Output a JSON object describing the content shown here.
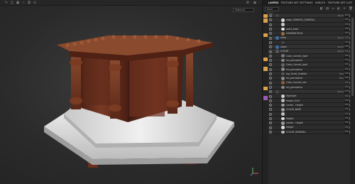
{
  "app": {
    "accent": "#d9a14a"
  },
  "viewport": {
    "view_select": "Base Color",
    "material_select": "Material",
    "toolbar_icons": [
      "brush-icon",
      "eraser-icon",
      "projection-icon",
      "smudge-icon",
      "clone-icon",
      "picker-icon",
      "polygon-fill-icon",
      "bake-icon",
      "settings-icon",
      "camera-icon"
    ]
  },
  "panel": {
    "tabs": [
      "LAYERS",
      "TEXTURE SET SETTINGS",
      "SHELFS",
      "TEXTURE SET LIST"
    ],
    "blend_select": "Base Color",
    "layers": [
      {
        "name": "",
        "kind": "folder",
        "swatch": "#444",
        "meta": "Norm",
        "val": "100",
        "accent": "#d9a14a",
        "indent": 18
      },
      {
        "name": "edge_GENERIC_GENERAL",
        "kind": "layer",
        "swatch": "#d8d8d8",
        "meta": "",
        "val": "100",
        "accent": "#d9a14a",
        "indent": 26
      },
      {
        "name": "",
        "kind": "layer",
        "swatch": "#c9c9c9",
        "meta": "",
        "val": "100",
        "accent": "",
        "indent": 26
      },
      {
        "name": "paint_base",
        "kind": "layer",
        "swatch": "#e4e4e4",
        "meta": "",
        "val": "100",
        "accent": "",
        "indent": 26
      },
      {
        "name": "GENERATOR02",
        "kind": "layer",
        "swatch": "#9a6a44",
        "meta": "",
        "val": "100",
        "accent": "#d9a14a",
        "indent": 26
      },
      {
        "name": "lamp",
        "kind": "folder",
        "swatch": "#3a6ea5",
        "meta": "Norm",
        "val": "100",
        "accent": "",
        "indent": 18
      },
      {
        "name": "",
        "kind": "layer",
        "swatch": "#444",
        "meta": "",
        "val": "100",
        "accent": "",
        "indent": 26
      },
      {
        "name": "wood",
        "kind": "folder",
        "swatch": "#3a6ea5",
        "meta": "Norm",
        "val": "100",
        "accent": "",
        "indent": 18
      },
      {
        "name": "COLOR",
        "kind": "folder",
        "swatch": "#555",
        "meta": "Norm",
        "val": "100",
        "accent": "",
        "indent": 18
      },
      {
        "name": "Color_Correct_light",
        "kind": "layer",
        "swatch": "#777",
        "meta": "",
        "val": "100",
        "accent": "#d9a14a",
        "indent": 26
      },
      {
        "name": "hsl_perceptive",
        "kind": "layer",
        "swatch": "#888",
        "meta": "",
        "val": "100",
        "accent": "",
        "indent": 26
      },
      {
        "name": "Color_Correct_dark",
        "kind": "layer",
        "swatch": "#666",
        "meta": "",
        "val": "100",
        "accent": "#d9a14a",
        "indent": 26
      },
      {
        "name": "hsl_perceptive",
        "kind": "layer",
        "swatch": "#888",
        "meta": "",
        "val": "100",
        "accent": "",
        "indent": 26
      },
      {
        "name": "fog_Gradi_Subtitle",
        "kind": "layer",
        "swatch": "#555",
        "meta": "Filte",
        "val": "100",
        "accent": "",
        "indent": 26
      },
      {
        "name": "hsl_perceptive",
        "kind": "layer",
        "swatch": "#888",
        "meta": "Filte",
        "val": "100",
        "accent": "",
        "indent": 26
      },
      {
        "name": "Color_Correct_red",
        "kind": "layer",
        "swatch": "#8a5a3a",
        "meta": "",
        "val": "100",
        "accent": "#d9a14a",
        "indent": 26
      },
      {
        "name": "hsl_perceptive",
        "kind": "layer",
        "swatch": "#888",
        "meta": "",
        "val": "100",
        "accent": "",
        "indent": 26
      },
      {
        "name": "",
        "kind": "folder",
        "swatch": "#444",
        "meta": "Norm",
        "val": "100",
        "accent": "#9b59b6",
        "indent": 18
      },
      {
        "name": "Highlight",
        "kind": "layer",
        "swatch": "#ccc",
        "meta": "",
        "val": "100",
        "accent": "",
        "indent": 26
      },
      {
        "name": "Height_ELM",
        "kind": "layer",
        "swatch": "#bbb",
        "meta": "",
        "val": "100",
        "accent": "",
        "indent": 26
      },
      {
        "name": "Levels - Height",
        "kind": "layer",
        "swatch": "#999",
        "meta": "",
        "val": "100",
        "accent": "",
        "indent": 26
      },
      {
        "name": "COLOR_BASE",
        "kind": "layer",
        "swatch": "#a0a0a0",
        "meta": "",
        "val": "100",
        "accent": "",
        "indent": 26
      },
      {
        "name": "",
        "kind": "layer",
        "swatch": "#c0c0c0",
        "meta": "",
        "val": "100",
        "accent": "",
        "indent": 26
      },
      {
        "name": "Height",
        "kind": "layer",
        "swatch": "#ddd",
        "meta": "",
        "val": "100",
        "accent": "",
        "indent": 26
      },
      {
        "name": "Levels - Height",
        "kind": "layer",
        "swatch": "#999",
        "meta": "",
        "val": "100",
        "accent": "",
        "indent": 26
      },
      {
        "name": "Height",
        "kind": "layer",
        "swatch": "#ddd",
        "meta": "",
        "val": "100",
        "accent": "",
        "indent": 26
      },
      {
        "name": "COLOR_GENERAL",
        "kind": "layer",
        "swatch": "#bbb",
        "meta": "",
        "val": "100",
        "accent": "",
        "indent": 26
      }
    ]
  }
}
